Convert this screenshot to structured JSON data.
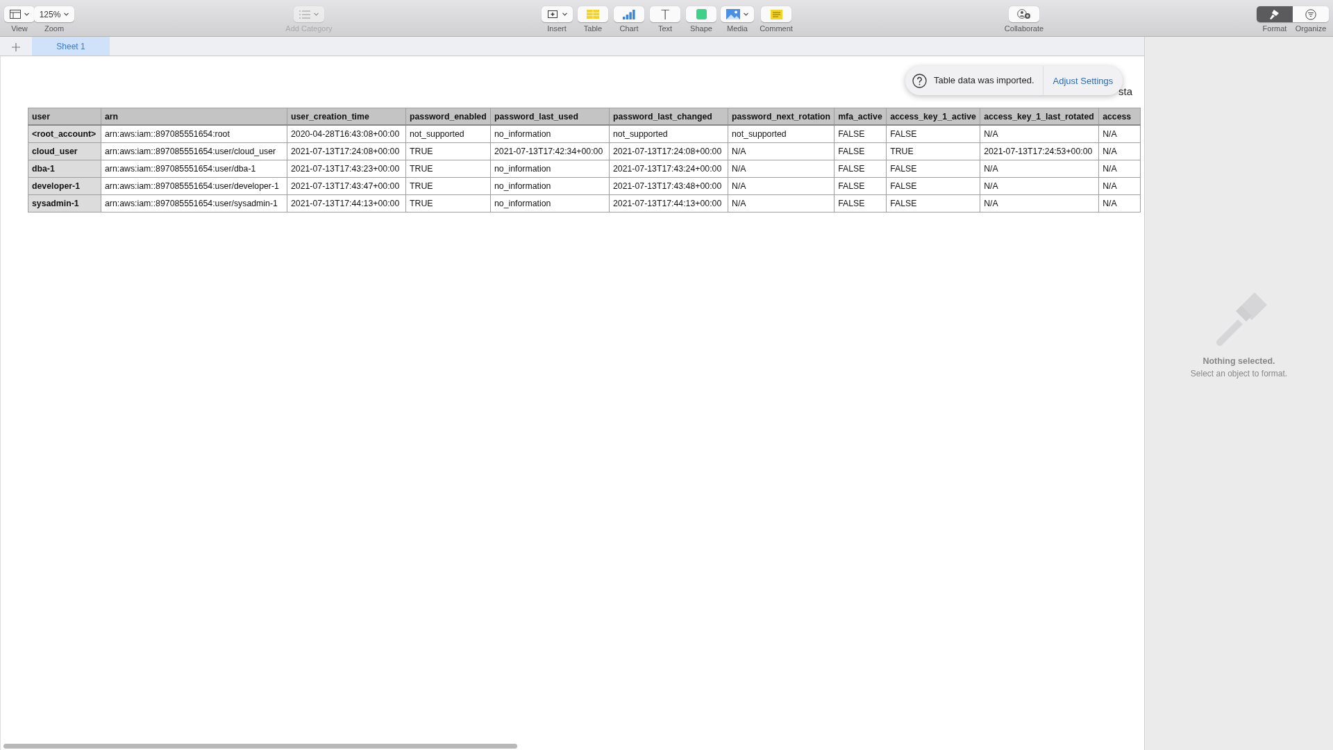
{
  "toolbar": {
    "left": [
      {
        "kind": "view",
        "label": "View"
      },
      {
        "kind": "zoom",
        "label": "Zoom",
        "value": "125%"
      }
    ],
    "add_category": {
      "label": "Add Category",
      "disabled": true
    },
    "center": [
      {
        "kind": "insert",
        "label": "Insert"
      },
      {
        "kind": "table",
        "label": "Table"
      },
      {
        "kind": "chart",
        "label": "Chart"
      },
      {
        "kind": "text",
        "label": "Text",
        "glyph": "T"
      },
      {
        "kind": "shape",
        "label": "Shape"
      },
      {
        "kind": "media",
        "label": "Media"
      },
      {
        "kind": "comment",
        "label": "Comment"
      }
    ],
    "collaborate": {
      "label": "Collaborate"
    },
    "right": [
      {
        "kind": "format",
        "label": "Format",
        "selected": true
      },
      {
        "kind": "organize",
        "label": "Organize",
        "selected": false
      }
    ]
  },
  "sheet_tabs": [
    {
      "label": "Sheet 1",
      "selected": true
    }
  ],
  "notification": {
    "message": "Table data was imported.",
    "action": "Adjust Settings"
  },
  "table_title_fragment": "sta",
  "table": {
    "columns": [
      "user",
      "arn",
      "user_creation_time",
      "password_enabled",
      "password_last_used",
      "password_last_changed",
      "password_next_rotation",
      "mfa_active",
      "access_key_1_active",
      "access_key_1_last_rotated",
      "access"
    ],
    "rows": [
      [
        "<root_account>",
        "arn:aws:iam::897085551654:root",
        "2020-04-28T16:43:08+00:00",
        "not_supported",
        "no_information",
        "not_supported",
        "not_supported",
        "FALSE",
        "FALSE",
        "N/A",
        "N/A"
      ],
      [
        "cloud_user",
        "arn:aws:iam::897085551654:user/cloud_user",
        "2021-07-13T17:24:08+00:00",
        "TRUE",
        "2021-07-13T17:42:34+00:00",
        "2021-07-13T17:24:08+00:00",
        "N/A",
        "FALSE",
        "TRUE",
        "2021-07-13T17:24:53+00:00",
        "N/A"
      ],
      [
        "dba-1",
        "arn:aws:iam::897085551654:user/dba-1",
        "2021-07-13T17:43:23+00:00",
        "TRUE",
        "no_information",
        "2021-07-13T17:43:24+00:00",
        "N/A",
        "FALSE",
        "FALSE",
        "N/A",
        "N/A"
      ],
      [
        "developer-1",
        "arn:aws:iam::897085551654:user/developer-1",
        "2021-07-13T17:43:47+00:00",
        "TRUE",
        "no_information",
        "2021-07-13T17:43:48+00:00",
        "N/A",
        "FALSE",
        "FALSE",
        "N/A",
        "N/A"
      ],
      [
        "sysadmin-1",
        "arn:aws:iam::897085551654:user/sysadmin-1",
        "2021-07-13T17:44:13+00:00",
        "TRUE",
        "no_information",
        "2021-07-13T17:44:13+00:00",
        "N/A",
        "FALSE",
        "FALSE",
        "N/A",
        "N/A"
      ]
    ]
  },
  "inspector": {
    "title": "Nothing selected.",
    "hint": "Select an object to format."
  }
}
